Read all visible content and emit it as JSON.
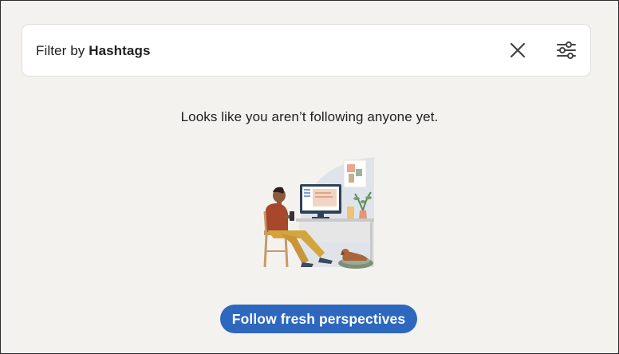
{
  "filter": {
    "prefix": "Filter by",
    "value": "Hashtags",
    "close_icon": "close-icon",
    "settings_icon": "sliders-icon"
  },
  "empty_state": {
    "message": "Looks like you aren’t following anyone yet.",
    "illustration": "person-at-desk-with-dog-illustration"
  },
  "cta": {
    "label": "Follow fresh perspectives"
  },
  "colors": {
    "background": "#f3f2ef",
    "card": "#ffffff",
    "button": "#2e67be",
    "button_text": "#ffffff",
    "text": "#1f1f1f"
  }
}
